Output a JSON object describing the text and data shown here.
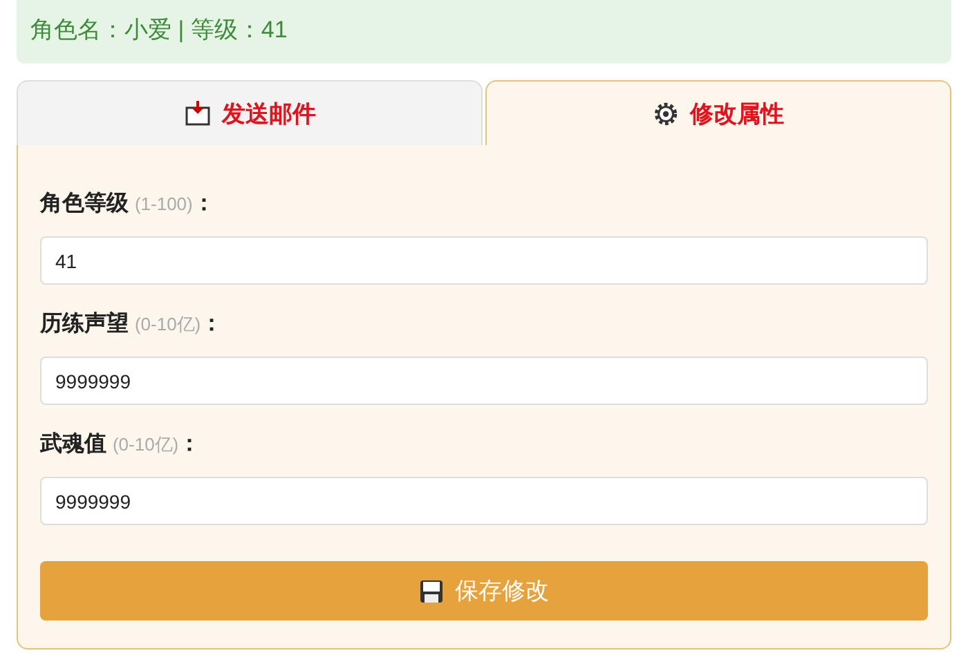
{
  "info_bar": {
    "text": "角色名：小爱 | 等级：41"
  },
  "tabs": [
    {
      "label": "发送邮件",
      "selected": false
    },
    {
      "label": "修改属性",
      "selected": true
    }
  ],
  "fields": [
    {
      "label": "角色等级",
      "hint": "(1-100)",
      "colon": "：",
      "value": "41"
    },
    {
      "label": "历练声望",
      "hint": "(0-10亿)",
      "colon": "：",
      "value": "9999999"
    },
    {
      "label": "武魂值",
      "hint": "(0-10亿)",
      "colon": "：",
      "value": "9999999"
    }
  ],
  "save_button": {
    "label": "保存修改"
  }
}
